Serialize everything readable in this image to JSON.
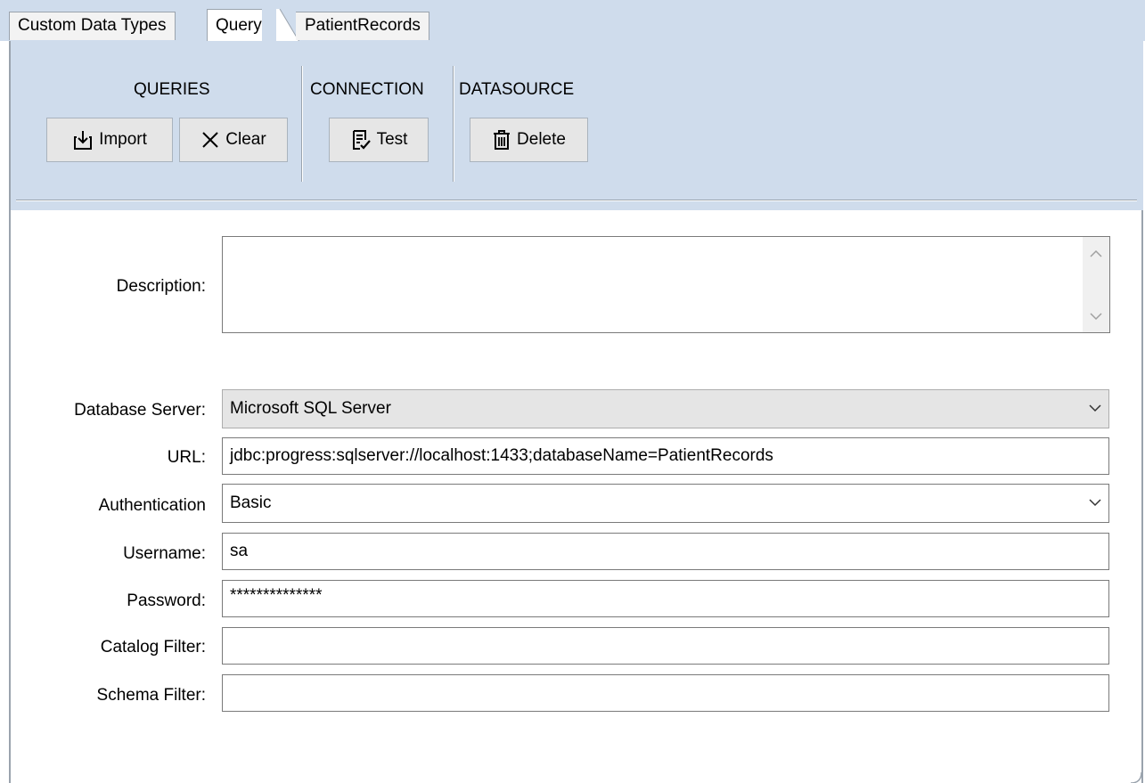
{
  "tabs": [
    {
      "label": "Custom Data Types",
      "active": false
    },
    {
      "label": "Query",
      "active": true
    },
    {
      "label": "PatientRecords",
      "active": false
    }
  ],
  "toolbar": {
    "queries_title": "QUERIES",
    "connection_title": "CONNECTION",
    "datasource_title": "DATASOURCE",
    "import_label": "Import",
    "clear_label": "Clear",
    "test_label": "Test",
    "delete_label": "Delete"
  },
  "form": {
    "description_label": "Description:",
    "description_value": "",
    "database_server_label": "Database Server:",
    "database_server_value": "Microsoft SQL Server",
    "url_label": "URL:",
    "url_value": "jdbc:progress:sqlserver://localhost:1433;databaseName=PatientRecords",
    "authentication_label": "Authentication",
    "authentication_value": "Basic",
    "username_label": "Username:",
    "username_value": "sa",
    "password_label": "Password:",
    "password_value": "**************",
    "catalog_filter_label": "Catalog Filter:",
    "catalog_filter_value": "",
    "schema_filter_label": "Schema Filter:",
    "schema_filter_value": ""
  },
  "colors": {
    "chrome_blue": "#cfdcec",
    "border": "#9aa3ad",
    "button_face": "#e6e6e6"
  }
}
